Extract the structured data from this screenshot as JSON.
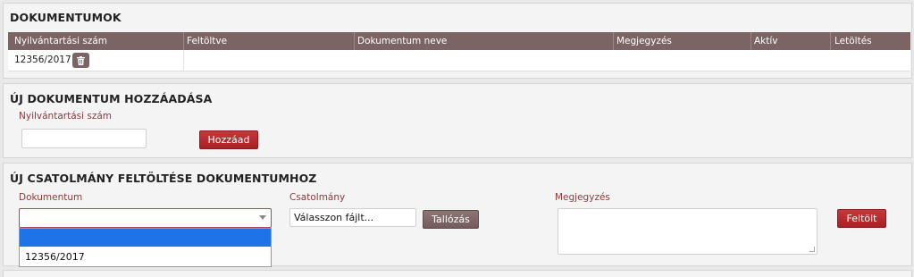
{
  "documents": {
    "title": "DOKUMENTUMOK",
    "columns": [
      "Nyilvántartási szám",
      "Feltöltve",
      "Dokumentum neve",
      "Megjegyzés",
      "Aktív",
      "Letöltés"
    ],
    "rows": [
      {
        "id": "12356/2017"
      }
    ]
  },
  "add_document": {
    "title": "ÚJ DOKUMENTUM HOZZÁADÁSA",
    "field_label": "Nyilvántartási szám",
    "field_value": "",
    "button_label": "Hozzáad"
  },
  "upload": {
    "title": "ÚJ CSATOLMÁNY FELTÖLTÉSE DOKUMENTUMHOZ",
    "document_label": "Dokumentum",
    "document_options": [
      "",
      "12356/2017"
    ],
    "attachment_label": "Csatolmány",
    "file_placeholder": "Válasszon fájlt...",
    "browse_label": "Tallózás",
    "note_label": "Megjegyzés",
    "note_value": "",
    "submit_label": "Feltölt"
  },
  "colors": {
    "header_bg": "#7b6463",
    "primary_red": "#b8292d",
    "selected_option": "#1e73e8"
  }
}
